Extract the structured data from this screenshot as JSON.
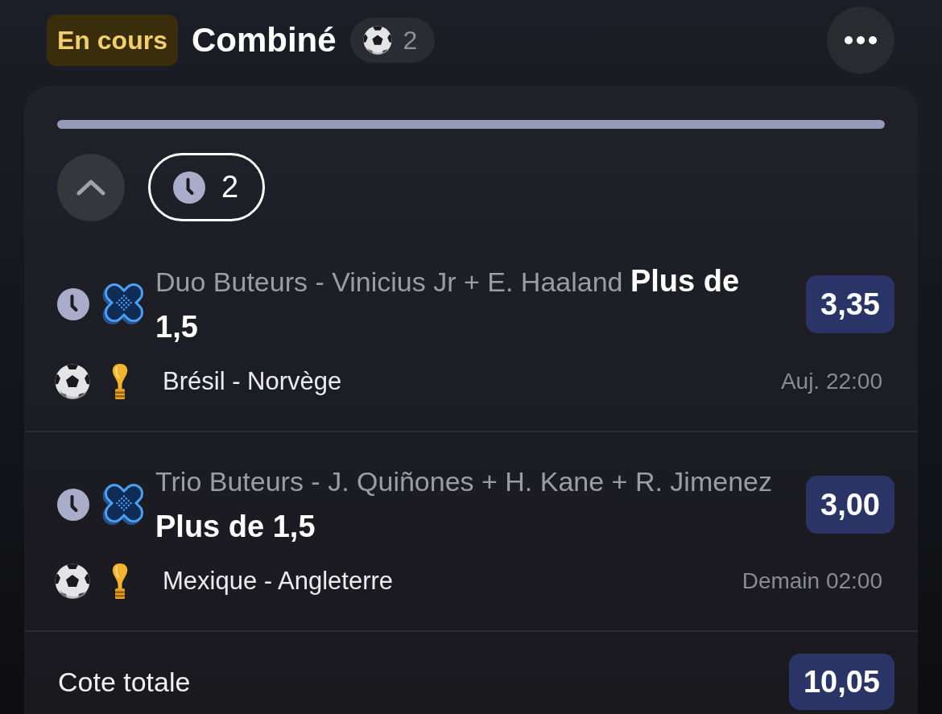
{
  "header": {
    "status": "En cours",
    "title": "Combiné",
    "sport_count": "2"
  },
  "progress": {
    "level": 1
  },
  "controls": {
    "expanded": true,
    "filter": {
      "count": "2",
      "selected": true
    }
  },
  "bets": [
    {
      "pending": true,
      "description": "Duo Buteurs - Vinicius Jr + E. Haaland **Plus de 1,5**",
      "odds": "3,35",
      "match": "Brésil - Norvège",
      "time": "Auj. 22:00"
    },
    {
      "pending": true,
      "description": "Trio Buteurs - J. Quiñones + H. Kane + R. Jimenez **Plus de 1,5**",
      "odds": "3,00",
      "match": "Mexique - Angleterre",
      "time": "Demain 02:00"
    }
  ],
  "total": {
    "label": "Cote totale",
    "odds": "10,05"
  }
}
